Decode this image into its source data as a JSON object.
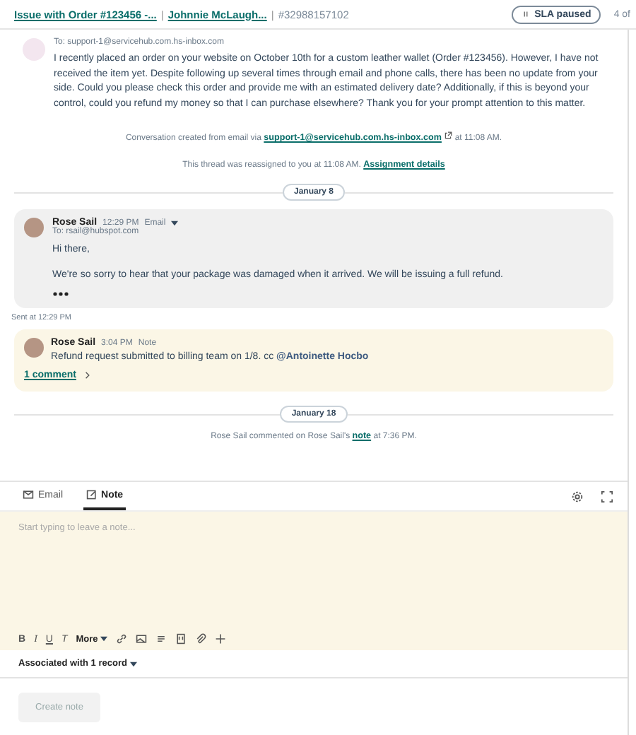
{
  "header": {
    "ticket_title": "Issue with Order #123456 -...",
    "contact": "Johnnie McLaugh...",
    "ticket_id": "#32988157102",
    "sla": "SLA paused",
    "pager": "4 of",
    "separators": [
      "|",
      "|"
    ]
  },
  "first_email": {
    "to": "To: support-1@servicehub.com.hs-inbox.com",
    "body": "I recently placed an order on your website on October 10th for a custom leather wallet (Order #123456). However, I have not received the item yet. Despite following up several times through email and phone calls, there has been no update from your side. Could you please check this order and provide me with an estimated delivery date? Additionally, if this is beyond your control, could you refund my money so that I can purchase elsewhere? Thank you for your prompt attention to this matter."
  },
  "created_notice": {
    "text": "Conversation created from email via",
    "link": "support-1@servicehub.com.hs-inbox.com",
    "time": "at 11:08 AM."
  },
  "reassign_notice": {
    "text": "This thread was reassigned to you at 11:08 AM.",
    "link": "Assignment details"
  },
  "date_1": "January 8",
  "reply": {
    "sender": "Rose Sail",
    "time": "12:29 PM",
    "channel": "Email",
    "to": "To: rsail@hubspot.com",
    "greeting": "Hi there,",
    "body": "We're so sorry to hear that your package was damaged when it arrived. We will be issuing a full refund.",
    "sent": "Sent at 12:29 PM"
  },
  "note": {
    "sender": "Rose Sail",
    "time": "3:04 PM",
    "type": "Note",
    "text": "Refund request submitted to billing team on 1/8. cc",
    "mention": "@Antoinette Hocbo",
    "comments": "1 comment"
  },
  "date_2": "January 18",
  "comment_notice": {
    "text": "Rose Sail commented on Rose Sail's",
    "link": "note",
    "time": "at 7:36 PM."
  },
  "composer": {
    "tabs": [
      {
        "label": "Email",
        "kind": "email",
        "selected": false
      },
      {
        "label": "Note",
        "kind": "note",
        "selected": true
      }
    ],
    "placeholder": "Start typing to leave a note...",
    "format_buttons": [
      {
        "label": "B",
        "kind": "bold"
      },
      {
        "label": "I",
        "kind": "italic"
      },
      {
        "label": "U",
        "kind": "underline"
      },
      {
        "label": "T",
        "kind": "clear"
      }
    ],
    "more": "More",
    "associated": "Associated with 1 record",
    "submit": {
      "label": "Create note",
      "disabled": true
    }
  }
}
